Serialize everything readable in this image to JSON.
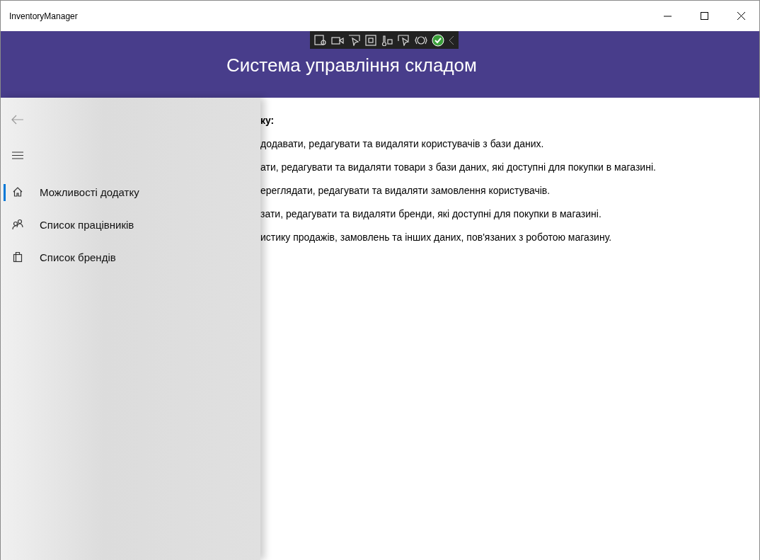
{
  "window": {
    "title": "InventoryManager"
  },
  "header": {
    "title": "Система управління складом"
  },
  "nav": {
    "items": [
      {
        "label": "Можливості додатку",
        "selected": true,
        "kind": "home"
      },
      {
        "label": "Список працівників",
        "selected": false,
        "kind": "people"
      },
      {
        "label": "Список брендів",
        "selected": false,
        "kind": "bag"
      }
    ]
  },
  "content": {
    "heading": "ку:",
    "lines": [
      "додавати, редагувати та видаляти користувачів з бази даних.",
      "ати, редагувати та видаляти товари з бази даних, які доступні для покупки в магазині.",
      "ереглядати, редагувати та видаляти замовлення користувачів.",
      "зати, редагувати та видаляти бренди, які доступні для покупки в магазині.",
      "истику продажів, замовлень та інших даних, пов'язаних з роботою магазину."
    ]
  }
}
